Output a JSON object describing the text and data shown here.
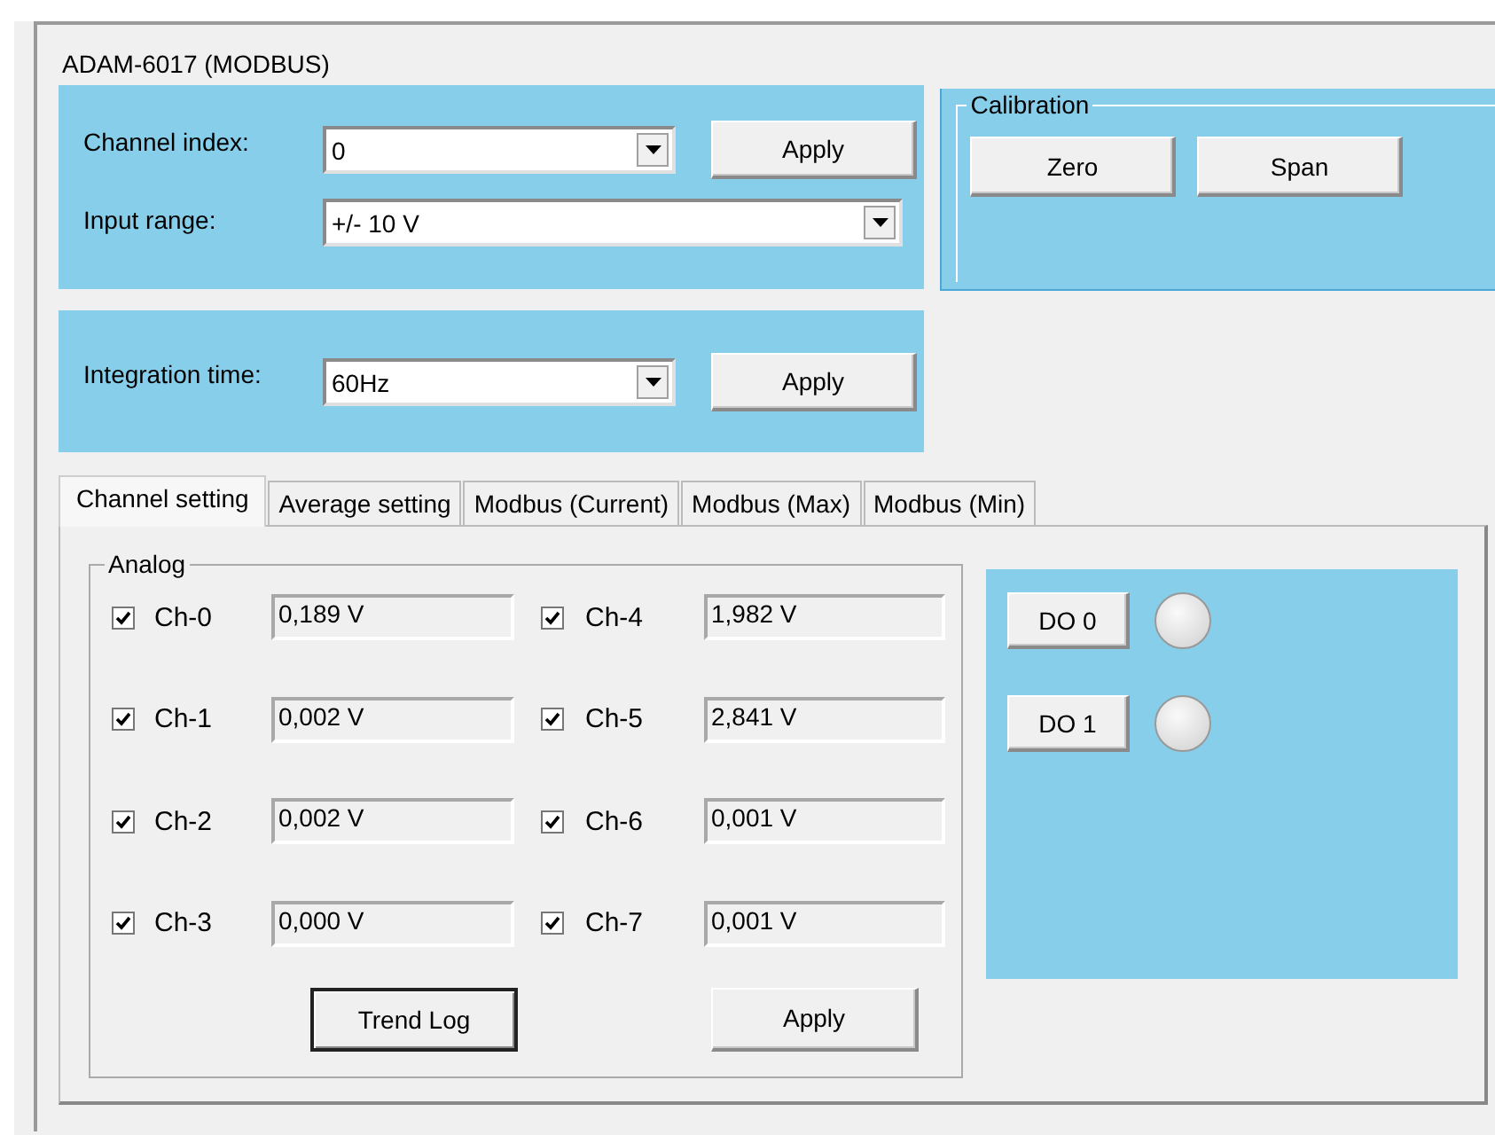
{
  "window": {
    "title": "ADAM-6017 (MODBUS)"
  },
  "channel_panel": {
    "channel_index": {
      "label": "Channel index:",
      "value": "0"
    },
    "apply_button": "Apply",
    "input_range": {
      "label": "Input range:",
      "value": "+/- 10 V"
    }
  },
  "calibration": {
    "title": "Calibration",
    "buttons": [
      "Zero",
      "Span"
    ]
  },
  "integration": {
    "label": "Integration time:",
    "value": "60Hz",
    "apply_button": "Apply"
  },
  "tabs": [
    {
      "label": "Channel setting",
      "selected": true
    },
    {
      "label": "Average setting",
      "selected": false
    },
    {
      "label": "Modbus (Current)",
      "selected": false
    },
    {
      "label": "Modbus (Max)",
      "selected": false
    },
    {
      "label": "Modbus (Min)",
      "selected": false
    }
  ],
  "analog": {
    "title": "Analog",
    "channels": [
      {
        "label": "Ch-0",
        "checked": true,
        "reading": "0,189 V"
      },
      {
        "label": "Ch-1",
        "checked": true,
        "reading": "0,002 V"
      },
      {
        "label": "Ch-2",
        "checked": true,
        "reading": "0,002 V"
      },
      {
        "label": "Ch-3",
        "checked": true,
        "reading": "0,000 V"
      },
      {
        "label": "Ch-4",
        "checked": true,
        "reading": "1,982 V"
      },
      {
        "label": "Ch-5",
        "checked": true,
        "reading": "2,841 V"
      },
      {
        "label": "Ch-6",
        "checked": true,
        "reading": "0,001 V"
      },
      {
        "label": "Ch-7",
        "checked": true,
        "reading": "0,001 V"
      }
    ],
    "buttons": [
      {
        "label": "Trend Log",
        "focused": true
      },
      {
        "label": "Apply",
        "focused": false
      }
    ]
  },
  "digital_outputs": [
    {
      "label": "DO 0",
      "on": false
    },
    {
      "label": "DO 1",
      "on": false
    }
  ]
}
